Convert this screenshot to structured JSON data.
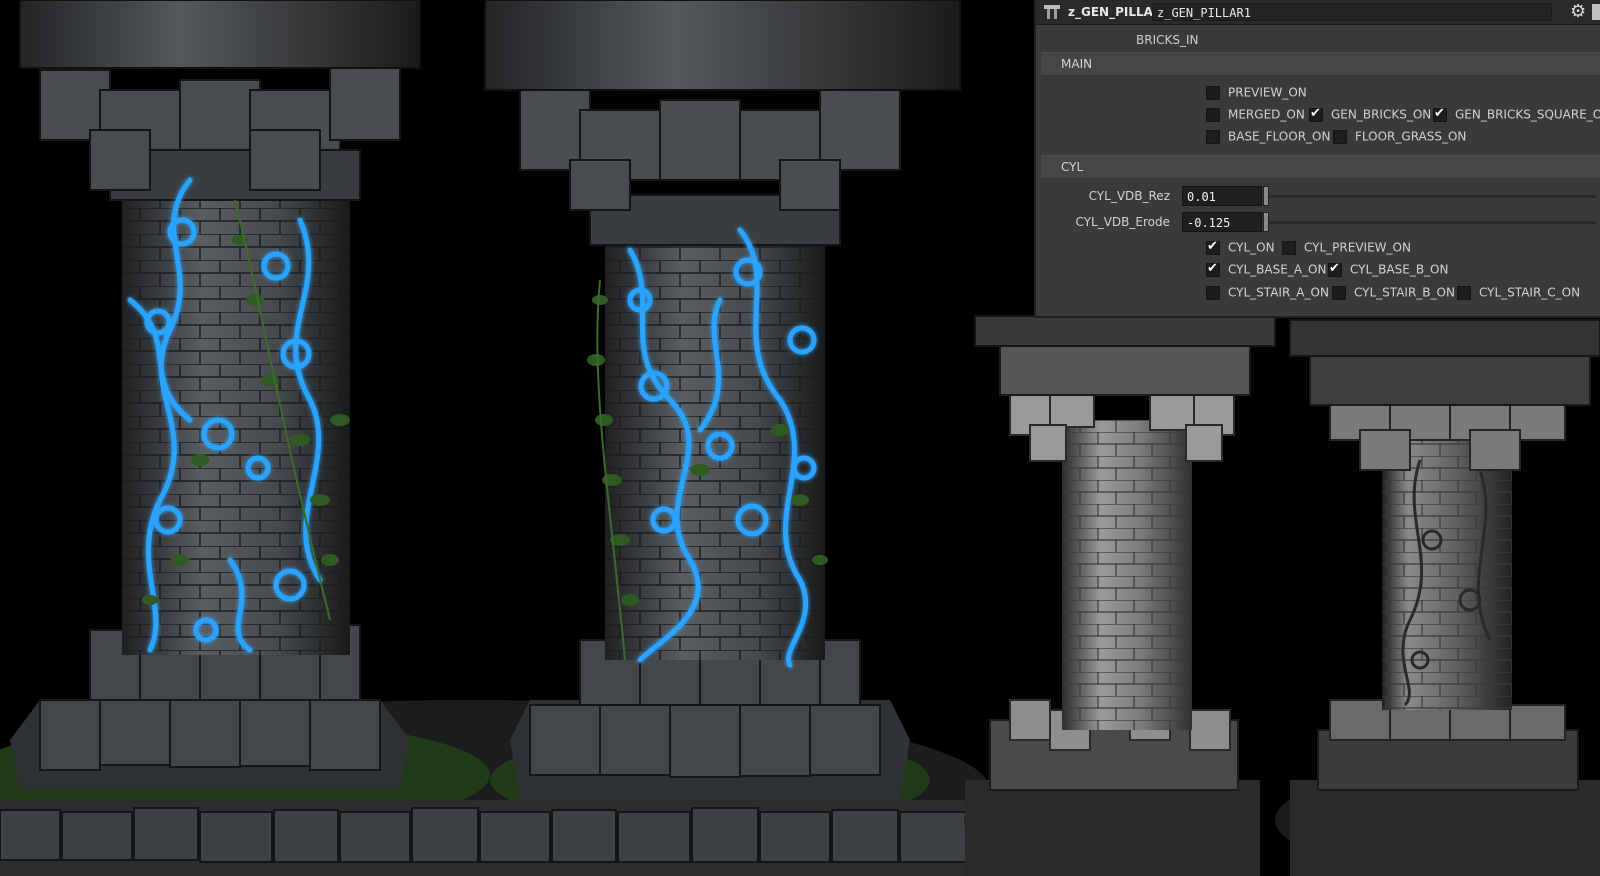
{
  "node": {
    "type": "z_GEN_PILLAR",
    "name": "z_GEN_PILLAR1",
    "gear_icon": "gear-icon",
    "help_icon": "help-icon"
  },
  "params": {
    "input_label": "BRICKS_IN",
    "main": {
      "title": "MAIN",
      "toggles": [
        {
          "label": "PREVIEW_ON",
          "checked": false
        },
        {
          "label": "MERGED_ON",
          "checked": false
        },
        {
          "label": "GEN_BRICKS_ON",
          "checked": true
        },
        {
          "label": "GEN_BRICKS_SQUARE_ON",
          "checked": true
        },
        {
          "label": "BASE_FLOOR_ON",
          "checked": false
        },
        {
          "label": "FLOOR_GRASS_ON",
          "checked": false
        }
      ]
    },
    "cyl": {
      "title": "CYL",
      "vdb_rez": {
        "label": "CYL_VDB_Rez",
        "value": "0.01"
      },
      "vdb_erode": {
        "label": "CYL_VDB_Erode",
        "value": "-0.125"
      },
      "toggles": [
        {
          "label": "CYL_ON",
          "checked": true
        },
        {
          "label": "CYL_PREVIEW_ON",
          "checked": false
        },
        {
          "label": "CYL_BASE_A_ON",
          "checked": true
        },
        {
          "label": "CYL_BASE_B_ON",
          "checked": true
        },
        {
          "label": "CYL_STAIR_A_ON",
          "checked": false
        },
        {
          "label": "CYL_STAIR_B_ON",
          "checked": false
        },
        {
          "label": "CYL_STAIR_C_ON",
          "checked": false
        }
      ]
    }
  },
  "colors": {
    "panel_bg": "#3a3a3a",
    "glow": "#2a9dff",
    "stone": "#3c3f42",
    "ivy": "#2f5a22"
  }
}
